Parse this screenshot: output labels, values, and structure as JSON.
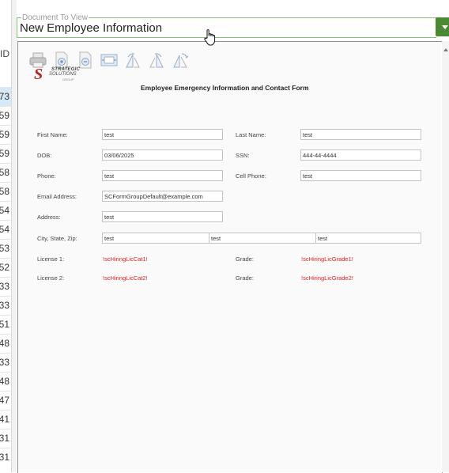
{
  "grid": {
    "header": "ID",
    "rows": [
      "73",
      "59",
      "59",
      "59",
      "58",
      "58",
      "54",
      "54",
      "53",
      "52",
      "33",
      "33",
      "51",
      "48",
      "33",
      "48",
      "47",
      "41",
      "31",
      "31"
    ]
  },
  "document_select": {
    "caption": "Document To View",
    "value": "New Employee Information"
  },
  "toolbar": {
    "icons": [
      "print-icon",
      "zoom-in-icon",
      "zoom-out-icon",
      "fit-page-icon",
      "rotate-left-icon",
      "rotate-right-icon",
      "rotate-icon"
    ]
  },
  "logo": {
    "mark": "S",
    "line1": "STRATEGIC",
    "line2": "SOLUTIONS",
    "line3": "GROUP"
  },
  "form": {
    "title": "Employee Emergency Information and Contact Form",
    "first_name_label": "First Name:",
    "first_name": "test",
    "last_name_label": "Last Name:",
    "last_name": "test",
    "dob_label": "DOB:",
    "dob": "03/06/2025",
    "ssn_label": "SSN:",
    "ssn": "444-44-4444",
    "phone_label": "Phone:",
    "phone": "test",
    "cell_phone_label": "Cell Phone:",
    "cell_phone": "test",
    "email_label": "Email Address:",
    "email": "SCFormGroupDefault@example.com",
    "address_label": "Address:",
    "address": "test",
    "city_state_zip_label": "City, State, Zip:",
    "city": "test",
    "state": "test",
    "zip": "test",
    "license1_label": "License 1:",
    "license1": "!scHiringLicCat1!",
    "grade1_label": "Grade:",
    "grade1": "!scHiringLicGrade1!",
    "license2_label": "License 2:",
    "license2": "!scHiringLicCat2!",
    "grade2_label": "Grade:",
    "grade2": "!scHiringLicGrade2!"
  },
  "colors": {
    "accent_green": "#4a8a35",
    "select_border": "#88c078",
    "placeholder_red": "#e02020",
    "logo_red": "#b22222"
  }
}
